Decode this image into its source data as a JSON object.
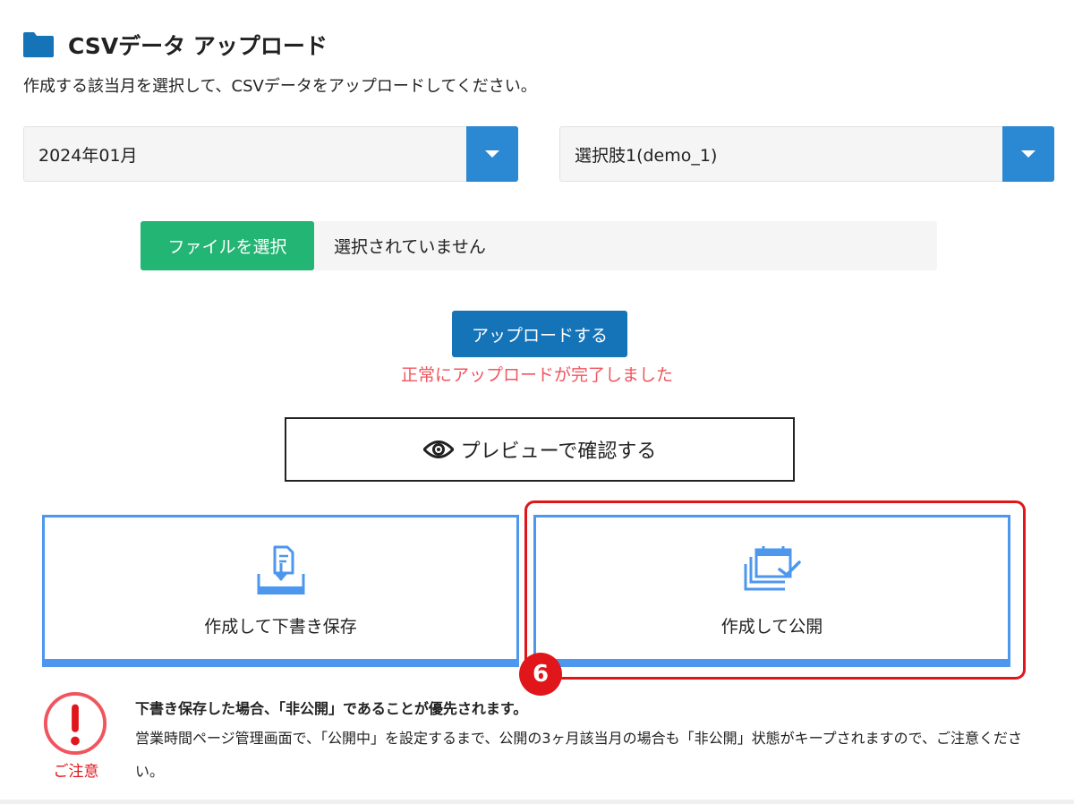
{
  "header": {
    "title": "CSVデータ アップロード",
    "subtitle": "作成する該当月を選択して、CSVデータをアップロードしてください。"
  },
  "month_select": {
    "value": "2024年01月"
  },
  "option_select": {
    "value": "選択肢1(demo_1)"
  },
  "file_upload": {
    "button_label": "ファイルを選択",
    "status": "選択されていません"
  },
  "upload": {
    "button_label": "アップロードする",
    "success_message": "正常にアップロードが完了しました"
  },
  "preview": {
    "button_label": "プレビューで確認する"
  },
  "actions": {
    "draft_label": "作成して下書き保存",
    "publish_label": "作成して公開"
  },
  "step_badge": "6",
  "caution": {
    "label": "ご注意",
    "heading": "下書き保存した場合、「非公開」であることが優先されます。",
    "body": "営業時間ページ管理画面で、「公開中」を設定するまで、公開の3ヶ月該当月の場合も「非公開」状態がキープされますので、ご注意ください。"
  },
  "colors": {
    "accent_blue": "#2b88d3",
    "upload_blue": "#1573b8",
    "file_green": "#22b573",
    "card_border": "#4d97ee",
    "highlight_red": "#e0161b",
    "success_text": "#f0555f"
  }
}
